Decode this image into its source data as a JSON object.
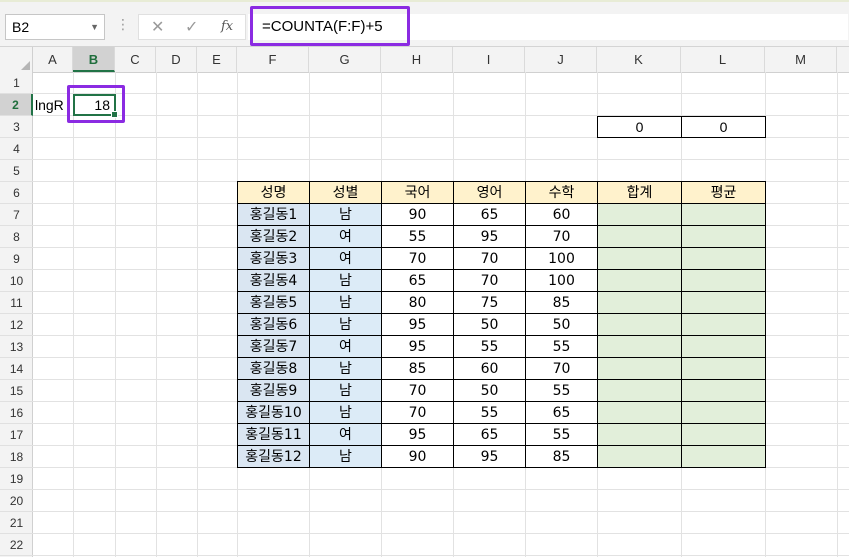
{
  "name_box": {
    "value": "B2"
  },
  "formula_bar": {
    "formula": "=COUNTA(F:F)+5",
    "fx_label": "fx"
  },
  "columns": [
    "A",
    "B",
    "C",
    "D",
    "E",
    "F",
    "G",
    "H",
    "I",
    "J",
    "K",
    "L",
    "M"
  ],
  "selected_column": "B",
  "rows": [
    "1",
    "2",
    "3",
    "4",
    "5",
    "6",
    "7",
    "8",
    "9",
    "10",
    "11",
    "12",
    "13",
    "14",
    "15",
    "16",
    "17",
    "18",
    "19",
    "20",
    "21",
    "22"
  ],
  "selected_row": "2",
  "cells": {
    "A2": "lngR",
    "B2": "18",
    "K3": "0",
    "L3": "0"
  },
  "table": {
    "headers": [
      "성명",
      "성별",
      "국어",
      "영어",
      "수학",
      "합계",
      "평균"
    ],
    "rows": [
      [
        "홍길동1",
        "남",
        "90",
        "65",
        "60",
        "",
        ""
      ],
      [
        "홍길동2",
        "여",
        "55",
        "95",
        "70",
        "",
        ""
      ],
      [
        "홍길동3",
        "여",
        "70",
        "70",
        "100",
        "",
        ""
      ],
      [
        "홍길동4",
        "남",
        "65",
        "70",
        "100",
        "",
        ""
      ],
      [
        "홍길동5",
        "남",
        "80",
        "75",
        "85",
        "",
        ""
      ],
      [
        "홍길동6",
        "남",
        "95",
        "50",
        "50",
        "",
        ""
      ],
      [
        "홍길동7",
        "여",
        "95",
        "55",
        "55",
        "",
        ""
      ],
      [
        "홍길동8",
        "남",
        "85",
        "60",
        "70",
        "",
        ""
      ],
      [
        "홍길동9",
        "남",
        "70",
        "50",
        "55",
        "",
        ""
      ],
      [
        "홍길동10",
        "남",
        "70",
        "55",
        "65",
        "",
        ""
      ],
      [
        "홍길동11",
        "여",
        "95",
        "65",
        "55",
        "",
        ""
      ],
      [
        "홍길동12",
        "남",
        "90",
        "95",
        "85",
        "",
        ""
      ]
    ]
  },
  "colors": {
    "header_fill": "#fff2cc",
    "name_fill": "#dae6f2",
    "total_fill": "#e2efda",
    "highlight": "#8b2be2",
    "selection": "#217346"
  },
  "icons": {
    "cancel": "cancel-x-icon",
    "enter": "enter-check-icon",
    "function": "insert-function-icon"
  }
}
